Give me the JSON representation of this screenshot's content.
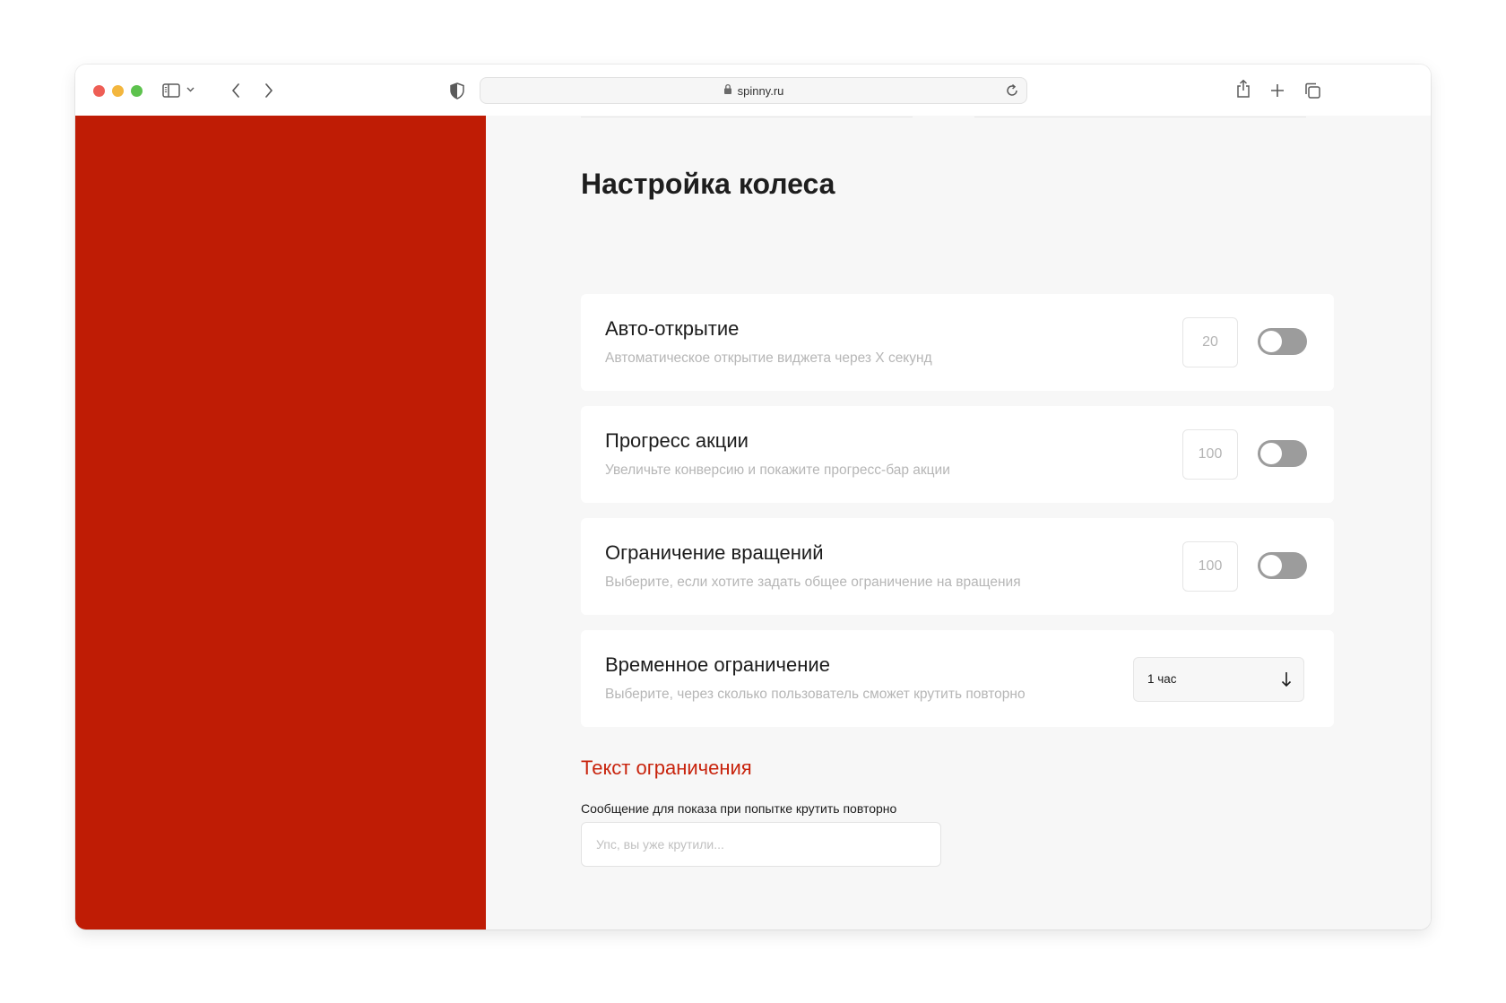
{
  "browser": {
    "url": "spinny.ru"
  },
  "page": {
    "title": "Настройка колеса"
  },
  "settings": [
    {
      "title": "Авто-открытие",
      "description": "Автоматическое открытие виджета через X секунд",
      "value": "20",
      "enabled": false
    },
    {
      "title": "Прогресс акции",
      "description": "Увеличьте конверсию и покажите прогресс-бар акции",
      "value": "100",
      "enabled": false
    },
    {
      "title": "Ограничение вращений",
      "description": "Выберите, если хотите задать общее ограничение на вращения",
      "value": "100",
      "enabled": false
    }
  ],
  "time_limit": {
    "title": "Временное ограничение",
    "description": "Выберите, через сколько пользователь сможет крутить повторно",
    "selected": "1 час"
  },
  "limit_text": {
    "section_title": "Текст ограничения",
    "label": "Сообщение для показа при попытке крутить повторно",
    "placeholder": "Упс, вы уже крутили..."
  },
  "colors": {
    "brand_red": "#bf1c05",
    "section_title_red": "#c8230c",
    "toggle_off": "#9c9c9c",
    "content_bg": "#f7f7f7"
  },
  "icons": {
    "traffic_lights": [
      "close-light",
      "minimize-light",
      "zoom-light"
    ],
    "toolbar": [
      "sidebar-icon",
      "chevron-down-icon",
      "back-icon",
      "forward-icon",
      "privacy-shield-icon",
      "lock-icon",
      "reload-icon",
      "share-icon",
      "new-tab-icon",
      "tabs-overview-icon"
    ],
    "select_arrow": "arrow-down-icon"
  }
}
